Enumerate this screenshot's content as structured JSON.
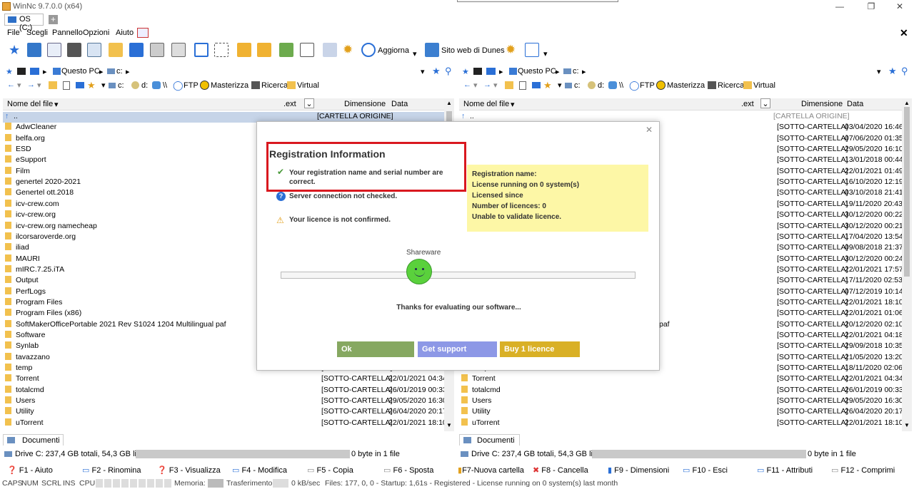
{
  "window": {
    "title": "WinNc 9.7.0.0 (x64)"
  },
  "tab": {
    "label": "OS (C:)",
    "add": "+"
  },
  "menu": [
    "File",
    "Scegli",
    "Pannello",
    "Opzioni",
    "Aiuto"
  ],
  "toolbar": {
    "refresh_label": "Aggiorna",
    "website_label": "Sito web di Dunes"
  },
  "left": {
    "crumbs": [
      "Questo PC",
      "c:"
    ],
    "nav": [
      "c:",
      "d:",
      "\\\\",
      "FTP",
      "Masterizza",
      "Ricerca",
      "Virtual"
    ],
    "headers": {
      "name": "Nome del file",
      "ext": ".ext",
      "size": "Dimensione",
      "date": "Data"
    },
    "parent": {
      "name": "..",
      "size": "[CARTELLA ORIGINE]"
    },
    "files": [
      {
        "name": "AdwCleaner"
      },
      {
        "name": "belfa.org"
      },
      {
        "name": "ESD"
      },
      {
        "name": "eSupport"
      },
      {
        "name": "Film"
      },
      {
        "name": "genertel 2020-2021"
      },
      {
        "name": "Genertel ott.2018"
      },
      {
        "name": "icv-crew.com"
      },
      {
        "name": "icv-crew.org"
      },
      {
        "name": "icv-crew.org namecheap"
      },
      {
        "name": "ilcorsaroverde.org"
      },
      {
        "name": "iliad"
      },
      {
        "name": "MAURI"
      },
      {
        "name": "mIRC.7.25.iTA"
      },
      {
        "name": "Output"
      },
      {
        "name": "PerfLogs"
      },
      {
        "name": "Program Files"
      },
      {
        "name": "Program Files (x86)"
      },
      {
        "name": "SoftMakerOfficePortable 2021 Rev S1024 1204 Multilingual paf"
      },
      {
        "name": "Software"
      },
      {
        "name": "Synlab"
      },
      {
        "name": "tavazzano"
      },
      {
        "name": "temp",
        "size": "[SOTTO-CARTELLA]",
        "date": "18/11/2020 02:06"
      },
      {
        "name": "Torrent",
        "size": "[SOTTO-CARTELLA]",
        "date": "22/01/2021 04:34"
      },
      {
        "name": "totalcmd",
        "size": "[SOTTO-CARTELLA]",
        "date": "26/01/2019 00:33"
      },
      {
        "name": "Users",
        "size": "[SOTTO-CARTELLA]",
        "date": "29/05/2020 16:30"
      },
      {
        "name": "Utility",
        "size": "[SOTTO-CARTELLA]",
        "date": "26/04/2020 20:17"
      },
      {
        "name": "uTorrent",
        "size": "[SOTTO-CARTELLA]",
        "date": "22/01/2021 18:10"
      }
    ],
    "docs": "Documenti",
    "drive": "Drive C: 237,4 GB totali, 54,3 GB liberi",
    "summary": "0 byte in 1 file"
  },
  "right": {
    "crumbs": [
      "Questo PC",
      "c:"
    ],
    "nav": [
      "c:",
      "d:",
      "\\\\",
      "FTP",
      "Masterizza",
      "Ricerca",
      "Virtual"
    ],
    "headers": {
      "name": "Nome del file",
      "ext": ".ext",
      "size": "Dimensione",
      "date": "Data"
    },
    "parent": {
      "name": "..",
      "size": "[CARTELLA ORIGINE]"
    },
    "rows": [
      {
        "size": "[SOTTO-CARTELLA]",
        "date": "03/04/2020 16:46"
      },
      {
        "size": "[SOTTO-CARTELLA]",
        "date": "07/06/2020 01:35"
      },
      {
        "size": "[SOTTO-CARTELLA]",
        "date": "29/05/2020 16:10"
      },
      {
        "size": "[SOTTO-CARTELLA]",
        "date": "13/01/2018 00:44"
      },
      {
        "size": "[SOTTO-CARTELLA]",
        "date": "22/01/2021 01:49"
      },
      {
        "size": "[SOTTO-CARTELLA]",
        "date": "16/10/2020 12:19"
      },
      {
        "size": "[SOTTO-CARTELLA]",
        "date": "03/10/2018 21:41"
      },
      {
        "size": "[SOTTO-CARTELLA]",
        "date": "19/11/2020 20:43"
      },
      {
        "size": "[SOTTO-CARTELLA]",
        "date": "30/12/2020 00:22"
      },
      {
        "size": "[SOTTO-CARTELLA]",
        "date": "30/12/2020 00:21"
      },
      {
        "size": "[SOTTO-CARTELLA]",
        "date": "17/04/2020 13:54"
      },
      {
        "size": "[SOTTO-CARTELLA]",
        "date": "09/08/2018 21:37"
      },
      {
        "size": "[SOTTO-CARTELLA]",
        "date": "30/12/2020 00:24"
      },
      {
        "size": "[SOTTO-CARTELLA]",
        "date": "22/01/2021 17:57"
      },
      {
        "size": "[SOTTO-CARTELLA]",
        "date": "17/11/2020 02:53"
      },
      {
        "size": "[SOTTO-CARTELLA]",
        "date": "07/12/2019 10:14"
      },
      {
        "size": "[SOTTO-CARTELLA]",
        "date": "22/01/2021 18:10"
      },
      {
        "size": "[SOTTO-CARTELLA]",
        "date": "22/01/2021 01:06"
      },
      {
        "name": "paf",
        "size": "[SOTTO-CARTELLA]",
        "date": "20/12/2020 02:10"
      },
      {
        "size": "[SOTTO-CARTELLA]",
        "date": "22/01/2021 04:18"
      },
      {
        "size": "[SOTTO-CARTELLA]",
        "date": "29/09/2018 10:35"
      },
      {
        "size": "[SOTTO-CARTELLA]",
        "date": "21/05/2020 13:20"
      },
      {
        "name": "temp",
        "size": "[SOTTO-CARTELLA]",
        "date": "18/11/2020 02:06"
      },
      {
        "name": "Torrent",
        "size": "[SOTTO-CARTELLA]",
        "date": "22/01/2021 04:34"
      },
      {
        "name": "totalcmd",
        "size": "[SOTTO-CARTELLA]",
        "date": "26/01/2019 00:33"
      },
      {
        "name": "Users",
        "size": "[SOTTO-CARTELLA]",
        "date": "29/05/2020 16:30"
      },
      {
        "name": "Utility",
        "size": "[SOTTO-CARTELLA]",
        "date": "26/04/2020 20:17"
      },
      {
        "name": "uTorrent",
        "size": "[SOTTO-CARTELLA]",
        "date": "22/01/2021 18:10"
      }
    ],
    "docs": "Documenti",
    "drive": "Drive C: 237,4 GB totali, 54,3 GB liberi",
    "summary": "0 byte in 1 file"
  },
  "fkeys": [
    "F1 - Aiuto",
    "F2 - Rinomina",
    "F3 - Visualizza",
    "F4 - Modifica",
    "F5 - Copia",
    "F6 - Sposta",
    "F7-Nuova cartella",
    "F8 - Cancella",
    "F9 - Dimensioni",
    "F10 - Esci",
    "F11 - Attributi",
    "F12 - Comprimi"
  ],
  "status": {
    "keys": [
      "CAPS",
      "NUM",
      "SCRL",
      "INS"
    ],
    "cpu": "CPU:",
    "memory": "Memoria:",
    "transfer": "Trasferimento:",
    "speed": "0 kB/sec",
    "info": "Files: 177, 0, 0 - Startup: 1,61s - Registered - License running on 0 system(s) last month"
  },
  "dialog": {
    "title": "Registration Information",
    "msg1": "Your registration name and serial number are correct.",
    "msg2": "Server connection not checked.",
    "msg3": "Your licence is not confirmed.",
    "info": [
      "Registration name:",
      "License running on 0 system(s)",
      "Licensed since",
      "Number of licences: 0",
      "Unable to validate licence."
    ],
    "level_label": "Shareware",
    "thanks": "Thanks for evaluating our software...",
    "ok": "Ok",
    "support": "Get support",
    "buy": "Buy 1 licence",
    "colors": {
      "ok": "#86a861",
      "support": "#8d98e6",
      "buy": "#d9b026",
      "info_bg": "#fdf7a6",
      "highlight": "#d9181f"
    }
  }
}
